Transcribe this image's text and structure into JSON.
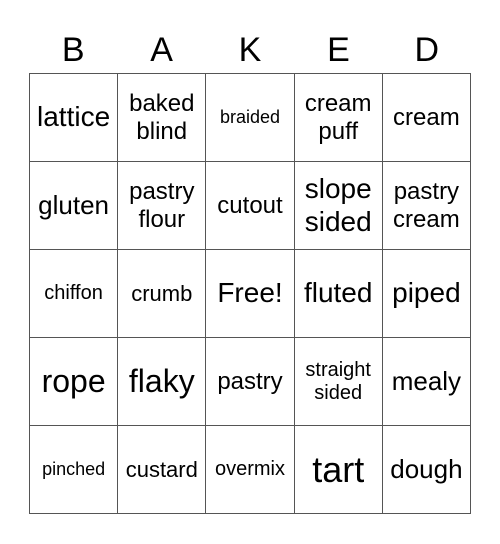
{
  "title_letters": [
    "B",
    "A",
    "K",
    "E",
    "D"
  ],
  "cells": [
    [
      "lattice",
      "baked blind",
      "braided",
      "cream puff",
      "cream"
    ],
    [
      "gluten",
      "pastry flour",
      "cutout",
      "slope sided",
      "pastry cream"
    ],
    [
      "chiffon",
      "crumb",
      "Free!",
      "fluted",
      "piped"
    ],
    [
      "rope",
      "flaky",
      "pastry",
      "straight sided",
      "mealy"
    ],
    [
      "pinched",
      "custard",
      "overmix",
      "tart",
      "dough"
    ]
  ]
}
